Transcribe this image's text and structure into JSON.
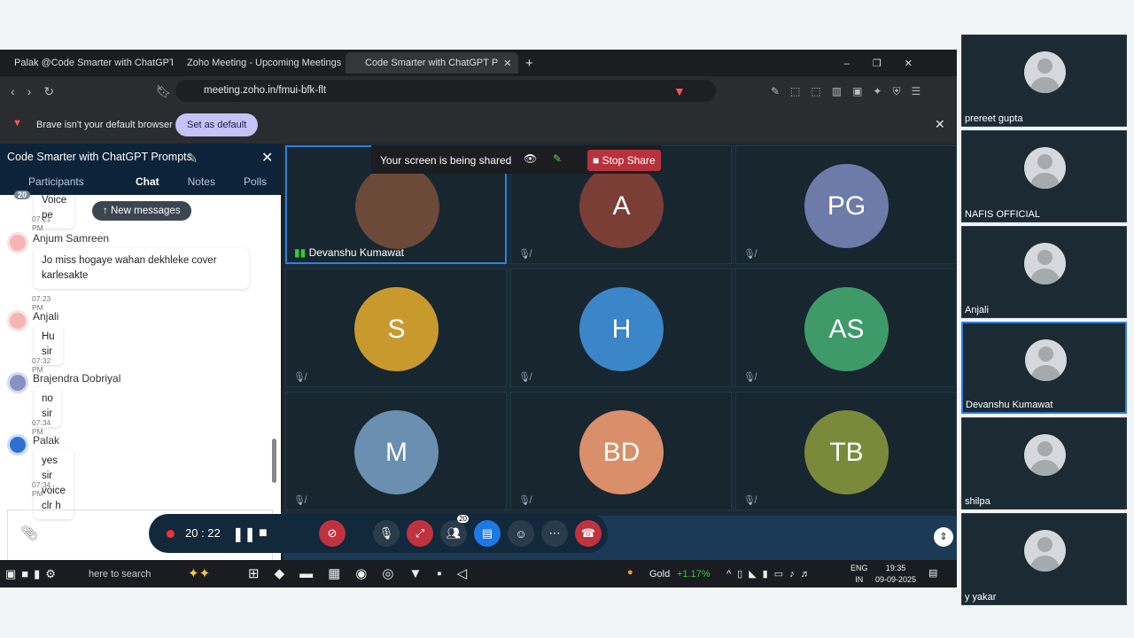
{
  "browser": {
    "tabs": [
      {
        "label": "Palak @Code Smarter with ChatGPT"
      },
      {
        "label": "Zoho Meeting - Upcoming Meetings"
      },
      {
        "label": "Code Smarter with ChatGPT P"
      }
    ],
    "url": "meeting.zoho.in/fmui-bfk-flt",
    "infobar": {
      "text": "Brave isn't your default browser",
      "button": "Set as default"
    }
  },
  "sidebar": {
    "title": "Code Smarter with ChatGPT Prompts",
    "tabs": [
      "Participants",
      "Chat",
      "Notes",
      "Polls"
    ],
    "participant_count": "20",
    "new_messages": "New messages",
    "messages": [
      {
        "name": "",
        "text": "Voice pe",
        "time": "07:21 PM"
      },
      {
        "name": "Anjum Samreen",
        "text": "Jo miss hogaye wahan dekhleke cover karlesakte",
        "time": "07:23 PM"
      },
      {
        "name": "Anjali",
        "text": "Hu sir",
        "time": "07:32 PM"
      },
      {
        "name": "Brajendra Dobriyal",
        "text": "no sir",
        "time": "07:34 PM"
      },
      {
        "name": "Palak",
        "text": "yes sir voice clr h",
        "time": "07:34 PM"
      }
    ]
  },
  "share_banner": {
    "text": "Your screen is being shared",
    "stop": "Stop Share"
  },
  "tiles": [
    {
      "initials": "",
      "name": "Devanshu Kumawat",
      "color": "#6b4a3a"
    },
    {
      "initials": "A",
      "color": "#7a3e36"
    },
    {
      "initials": "PG",
      "color": "#6e7aa8"
    },
    {
      "initials": "S",
      "color": "#c89a2e"
    },
    {
      "initials": "H",
      "color": "#3a86c8"
    },
    {
      "initials": "AS",
      "color": "#3f9a6a"
    },
    {
      "initials": "M",
      "color": "#6a8fb0"
    },
    {
      "initials": "BD",
      "color": "#d98f6a"
    },
    {
      "initials": "TB",
      "color": "#7a8a3a"
    }
  ],
  "controls": {
    "timer": "20 : 22",
    "participants_badge": "20"
  },
  "taskbar": {
    "search": "here to search",
    "gold": "Gold",
    "gold_change": "+1.17%",
    "lang": "ENG",
    "region": "IN",
    "time": "19:35",
    "date": "09-09-2025"
  },
  "thumbs": [
    "prereet gupta",
    "NAFIS OFFICIAL",
    "Anjali",
    "Devanshu Kumawat",
    "shilpa",
    "y yakar"
  ]
}
